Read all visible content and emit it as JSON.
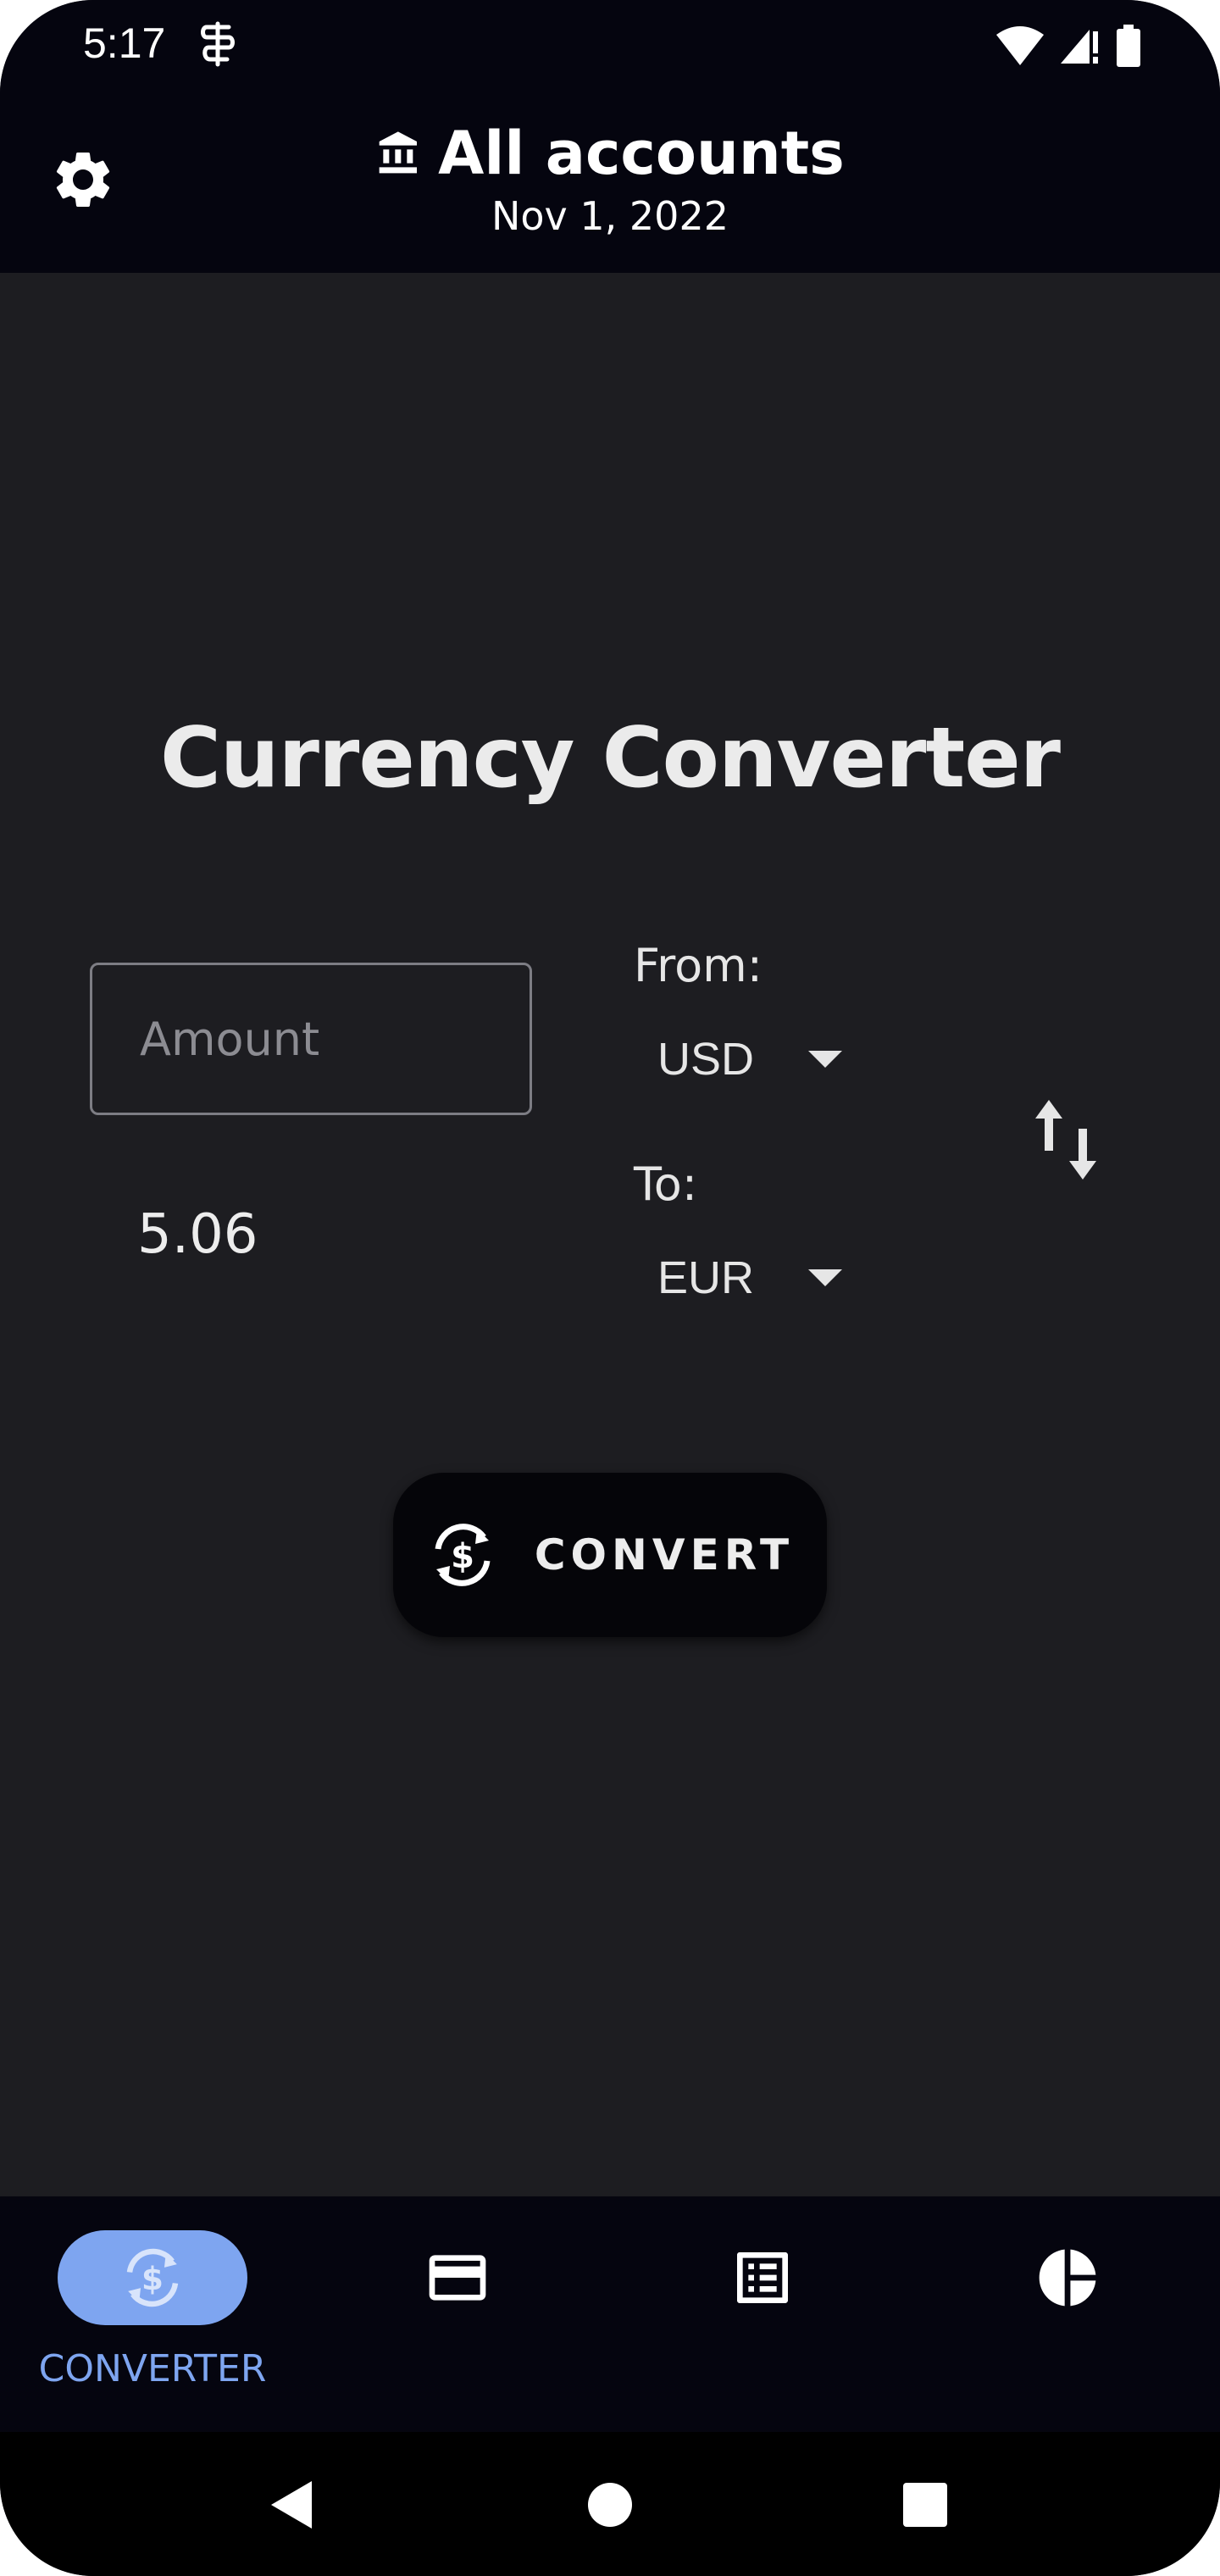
{
  "status_bar": {
    "time": "5:17",
    "app_icon": "notification-app-icon",
    "icons": [
      "wifi-icon",
      "signal-icon",
      "battery-icon"
    ]
  },
  "header": {
    "title": "All accounts",
    "date": "Nov 1, 2022",
    "settings_icon": "gear-icon",
    "title_icon": "bank-icon"
  },
  "converter": {
    "title": "Currency Converter",
    "amount_placeholder": "Amount",
    "amount_value": "",
    "result": "5.06",
    "from_label": "From:",
    "from_currency": "USD",
    "to_label": "To:",
    "to_currency": "EUR",
    "convert_label": "CONVERT"
  },
  "bottom_nav": {
    "items": [
      {
        "label": "CONVERTER",
        "icon": "currency-exchange-icon",
        "active": true
      },
      {
        "label": "",
        "icon": "credit-card-icon",
        "active": false
      },
      {
        "label": "",
        "icon": "list-icon",
        "active": false
      },
      {
        "label": "",
        "icon": "pie-chart-icon",
        "active": false
      }
    ]
  },
  "colors": {
    "background": "#1d1d21",
    "header_bg": "#05050f",
    "accent": "#7ea5f0",
    "text": "#e6e6e6"
  }
}
